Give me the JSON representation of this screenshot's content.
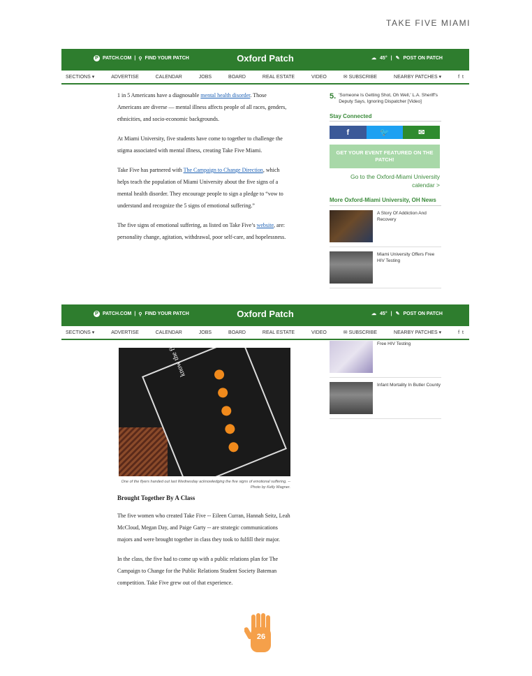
{
  "page": {
    "header": "TAKE FIVE MIAMI",
    "page_number": "26"
  },
  "patch_header": {
    "patch_link": "PATCH.COM",
    "find_link": "FIND YOUR PATCH",
    "site_title": "Oxford Patch",
    "temperature": "45°",
    "post_link": "POST ON PATCH"
  },
  "nav": [
    "SECTIONS ▾",
    "ADVERTISE",
    "CALENDAR",
    "JOBS",
    "BOARD",
    "REAL ESTATE",
    "VIDEO",
    "SUBSCRIBE",
    "NEARBY PATCHES ▾"
  ],
  "article1": {
    "p1_a": "1 in 5 Americans have a diagnosable ",
    "p1_link": "mental health disorder",
    "p1_b": ". Those Americans are diverse — mental illness affects people of all races, genders, ethnicities, and socio-economic backgrounds.",
    "p2": "At Miami University, five students have come to together to challenge the stigma associated with mental illness, creating Take Five Miami.",
    "p3_a": "Take Five has partnered with ",
    "p3_link": "The Campaign to Change Direction",
    "p3_b": ", which helps teach the population of Miami University about the five signs of a mental health disorder. They encourage people to sign a pledge to “vow to understand and recognize the 5 signs of emotional suffering.”",
    "p4_a": "The five signs of emotional suffering, as listed on Take Five’s ",
    "p4_link": "website",
    "p4_b": ", are: personality change, agitation, withdrawal, poor self-care, and hopelessness."
  },
  "sidebar1": {
    "item5_num": "5.",
    "item5_text": "'Someone Is Getting Shot, Oh Well,' L.A. Sheriff's Deputy Says, Ignoring Dispatcher [Video]",
    "stay_connected": "Stay Connected",
    "cta": "GET YOUR EVENT FEATURED ON THE PATCH!",
    "calendar_link": "Go to the Oxford-Miami University calendar >",
    "more_news": "More Oxford-Miami University, OH News",
    "news": [
      {
        "title": "A Story Of Addiction And Recovery"
      },
      {
        "title": "Miami University Offers Free HIV Testing"
      }
    ]
  },
  "sidebar2": {
    "news": [
      {
        "title": "Free HIV Testing"
      },
      {
        "title": "Infant Mortality In Butler County"
      }
    ]
  },
  "article2": {
    "photo_text": "know the five signs",
    "caption": "One of the flyers handed out last Wednesday acknowledging the five signs of emotional suffering. -- Photo by Kelly Wagner.",
    "heading": "Brought Together By A Class",
    "p1": "The five women who created Take Five -- Eileen Curran, Hannah Seitz, Leah McCloud, Megan Day, and Paige Garty -- are strategic communications majors and were brought together in class they took to fulfill their major.",
    "p2": "In the class, the five had to come up with a public relations plan for The Campaign to Change for the Public Relations Student Society Bateman competition. Take Five grew out of that experience."
  },
  "colors": {
    "patch_green": "#2e7d2e",
    "link_blue": "#1a5fb4",
    "hand_orange": "#f5a04a"
  }
}
